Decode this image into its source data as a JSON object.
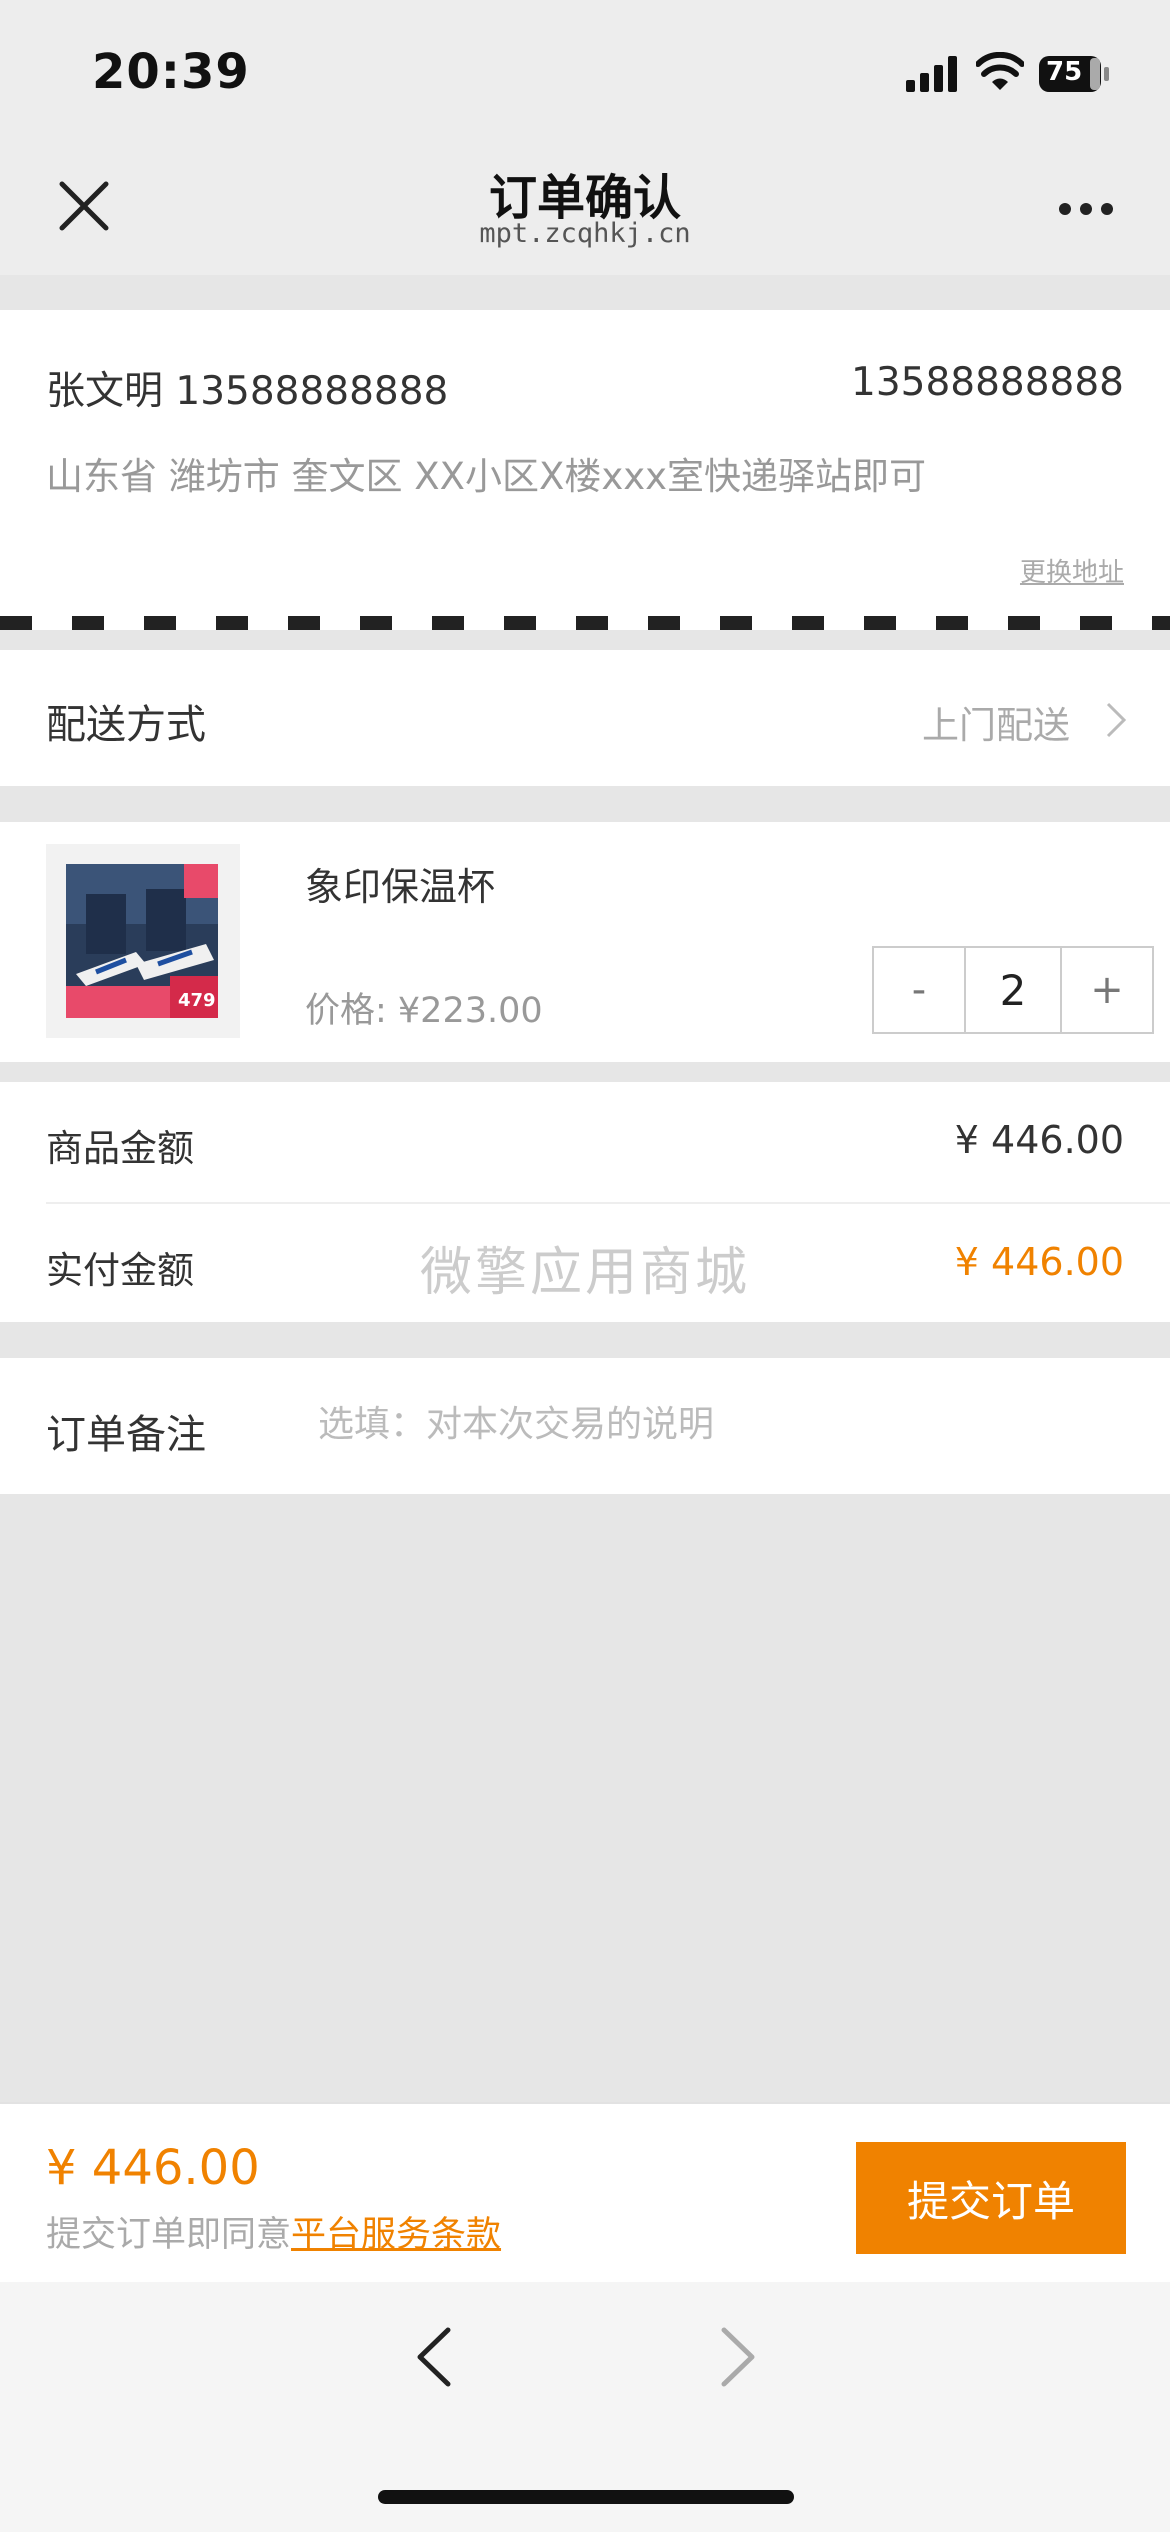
{
  "status_bar": {
    "time": "20:39",
    "battery": "75"
  },
  "navbar": {
    "title": "订单确认",
    "subtitle": "mpt.zcqhkj.cn"
  },
  "address": {
    "name_phone": "张文明 13588888888",
    "phone": "13588888888",
    "detail": "山东省 潍坊市 奎文区 XX小区X楼xxx室快递驿站即可",
    "change_label": "更换地址"
  },
  "delivery": {
    "label": "配送方式",
    "value": "上门配送"
  },
  "product": {
    "name": "象印保温杯",
    "price_label": "价格: ¥223.00",
    "quantity": "2",
    "minus": "-",
    "plus": "+",
    "thumb_badge": "479"
  },
  "amounts": {
    "goods_label": "商品金额",
    "goods_value": "¥ 446.00",
    "paid_label": "实付金额",
    "paid_value": "¥ 446.00",
    "watermark": "微擎应用商城"
  },
  "note": {
    "label": "订单备注",
    "placeholder": "选填：对本次交易的说明"
  },
  "bottom": {
    "total": "¥ 446.00",
    "agree_prefix": "提交订单即同意",
    "terms_link": "平台服务条款",
    "submit": "提交订单"
  },
  "colors": {
    "accent": "#f08200",
    "background": "#e6e6e6"
  }
}
